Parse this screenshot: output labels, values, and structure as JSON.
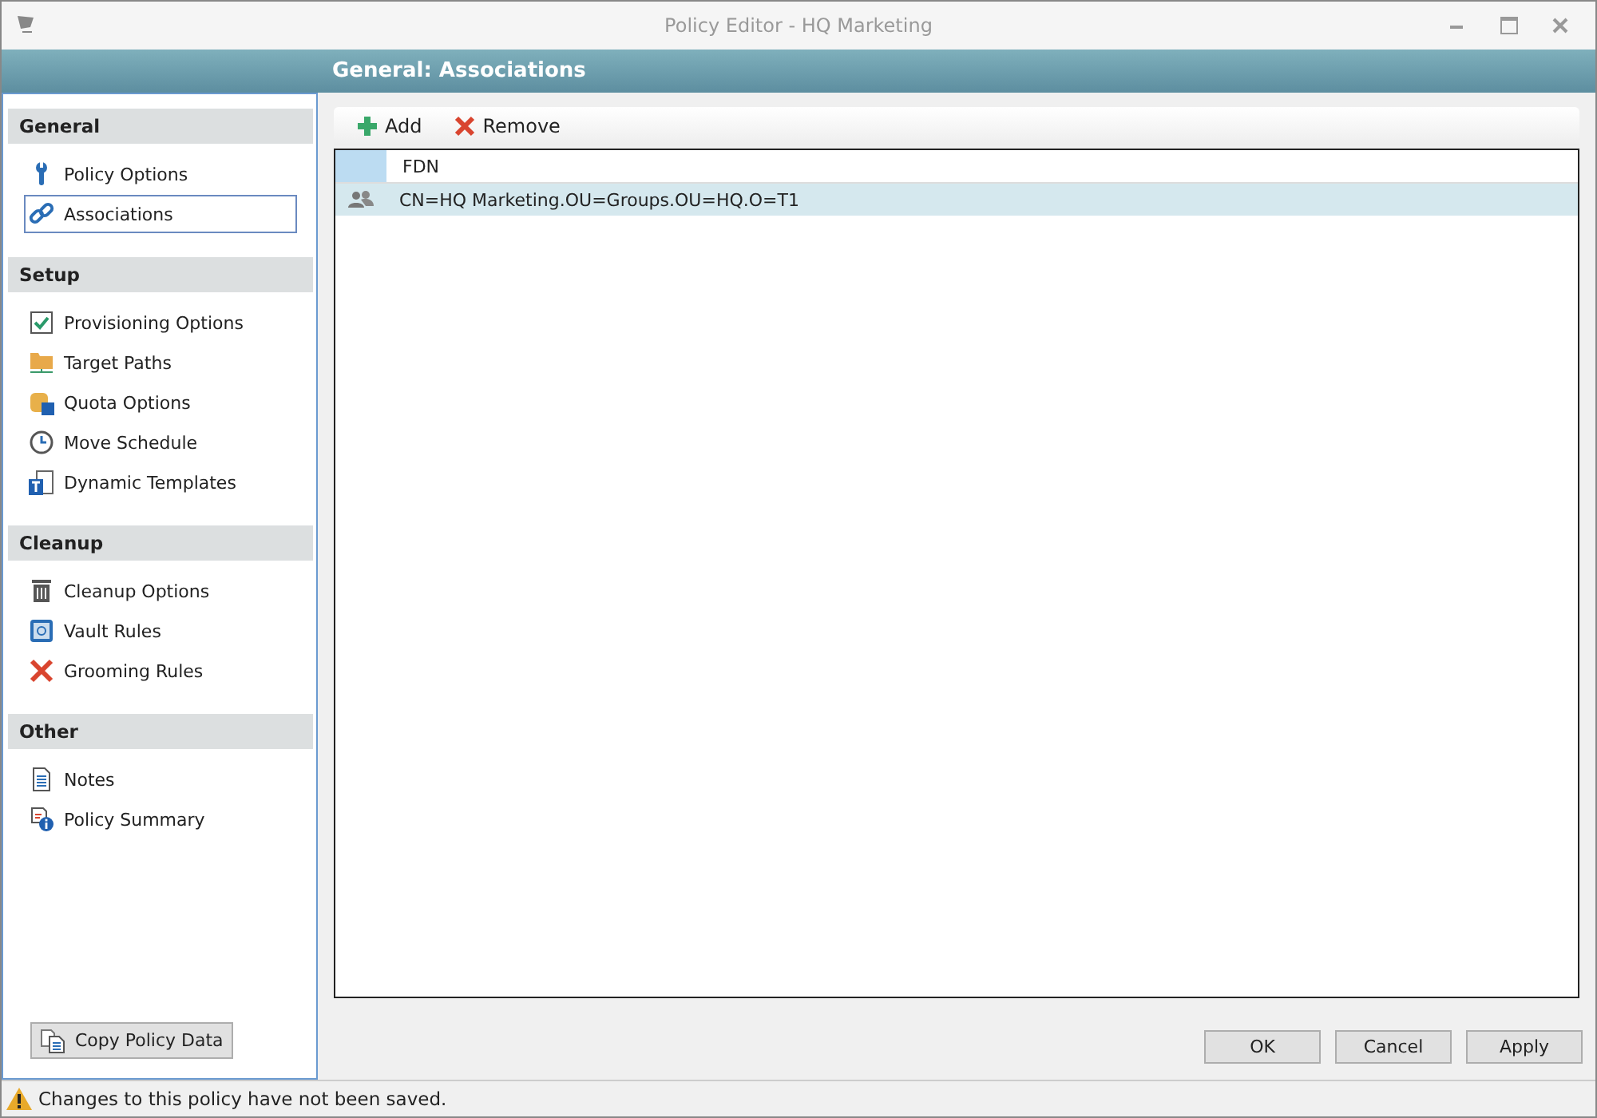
{
  "window": {
    "title": "Policy Editor - HQ Marketing"
  },
  "header": {
    "title": "General: Associations"
  },
  "sidebar": {
    "sections": [
      {
        "title": "General",
        "items": [
          {
            "label": "Policy Options",
            "selected": false
          },
          {
            "label": "Associations",
            "selected": true
          }
        ]
      },
      {
        "title": "Setup",
        "items": [
          {
            "label": "Provisioning Options",
            "selected": false
          },
          {
            "label": "Target Paths",
            "selected": false
          },
          {
            "label": "Quota Options",
            "selected": false
          },
          {
            "label": "Move Schedule",
            "selected": false
          },
          {
            "label": "Dynamic Templates",
            "selected": false
          }
        ]
      },
      {
        "title": "Cleanup",
        "items": [
          {
            "label": "Cleanup Options",
            "selected": false
          },
          {
            "label": "Vault Rules",
            "selected": false
          },
          {
            "label": "Grooming Rules",
            "selected": false
          }
        ]
      },
      {
        "title": "Other",
        "items": [
          {
            "label": "Notes",
            "selected": false
          },
          {
            "label": "Policy Summary",
            "selected": false
          }
        ]
      }
    ],
    "copy_button": "Copy Policy Data"
  },
  "toolbar": {
    "add": "Add",
    "remove": "Remove"
  },
  "table": {
    "columns": [
      "FDN"
    ],
    "rows": [
      {
        "fdn": "CN=HQ Marketing.OU=Groups.OU=HQ.O=T1",
        "selected": true
      }
    ]
  },
  "buttons": [
    "OK",
    "Cancel",
    "Apply"
  ],
  "status_bar": {
    "message": "Changes to this policy have not been saved."
  }
}
